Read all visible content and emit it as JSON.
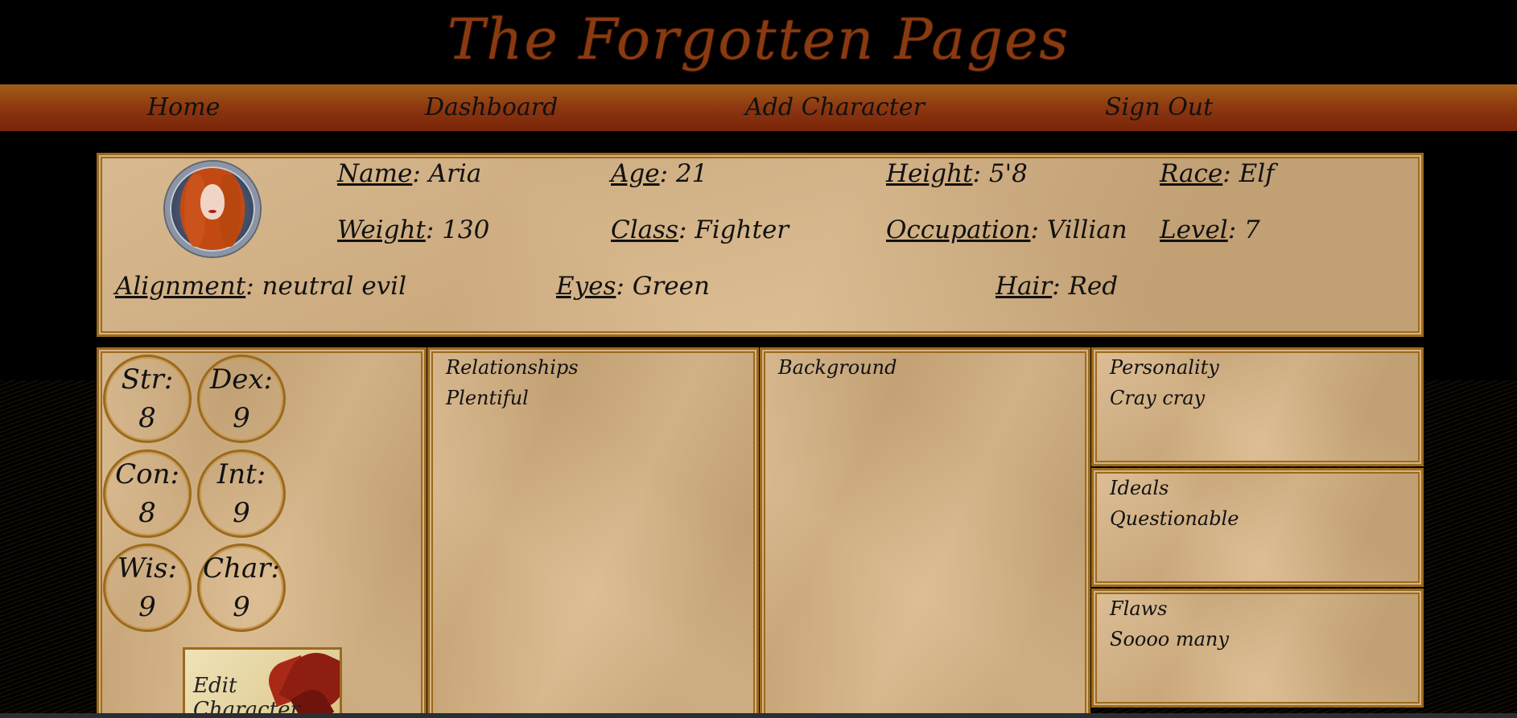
{
  "site": {
    "title": "The Forgotten Pages"
  },
  "nav": {
    "home": "Home",
    "dashboard": "Dashboard",
    "add_character": "Add Character",
    "sign_out": "Sign Out"
  },
  "character": {
    "name": {
      "label": "Name",
      "value": "Aria"
    },
    "age": {
      "label": "Age",
      "value": "21"
    },
    "height": {
      "label": "Height",
      "value": "5'8"
    },
    "race": {
      "label": "Race",
      "value": "Elf"
    },
    "weight": {
      "label": "Weight",
      "value": "130"
    },
    "class": {
      "label": "Class",
      "value": "Fighter"
    },
    "occupation": {
      "label": "Occupation",
      "value": "Villian"
    },
    "level": {
      "label": "Level",
      "value": "7"
    },
    "alignment": {
      "label": "Alignment",
      "value": "neutral evil"
    },
    "eyes": {
      "label": "Eyes",
      "value": "Green"
    },
    "hair": {
      "label": "Hair",
      "value": "Red"
    }
  },
  "stats": {
    "str": {
      "label": "Str:",
      "value": "8"
    },
    "dex": {
      "label": "Dex:",
      "value": "9"
    },
    "con": {
      "label": "Con:",
      "value": "8"
    },
    "int": {
      "label": "Int:",
      "value": "9"
    },
    "wis": {
      "label": "Wis:",
      "value": "9"
    },
    "char": {
      "label": "Char:",
      "value": "9"
    }
  },
  "edit": {
    "label": "Edit Character"
  },
  "panels": {
    "relationships": {
      "heading": "Relationships",
      "body": "Plentiful"
    },
    "background": {
      "heading": "Background",
      "body": ""
    },
    "personality": {
      "heading": "Personality",
      "body": "Cray cray"
    },
    "ideals": {
      "heading": "Ideals",
      "body": "Questionable"
    },
    "flaws": {
      "heading": "Flaws",
      "body": "Soooo many"
    }
  },
  "colors": {
    "parchment": "#d8b382",
    "border": "#9a6a1d",
    "nav_top": "#a35d16",
    "nav_bottom": "#7a2508",
    "title": "#8a3a10"
  }
}
